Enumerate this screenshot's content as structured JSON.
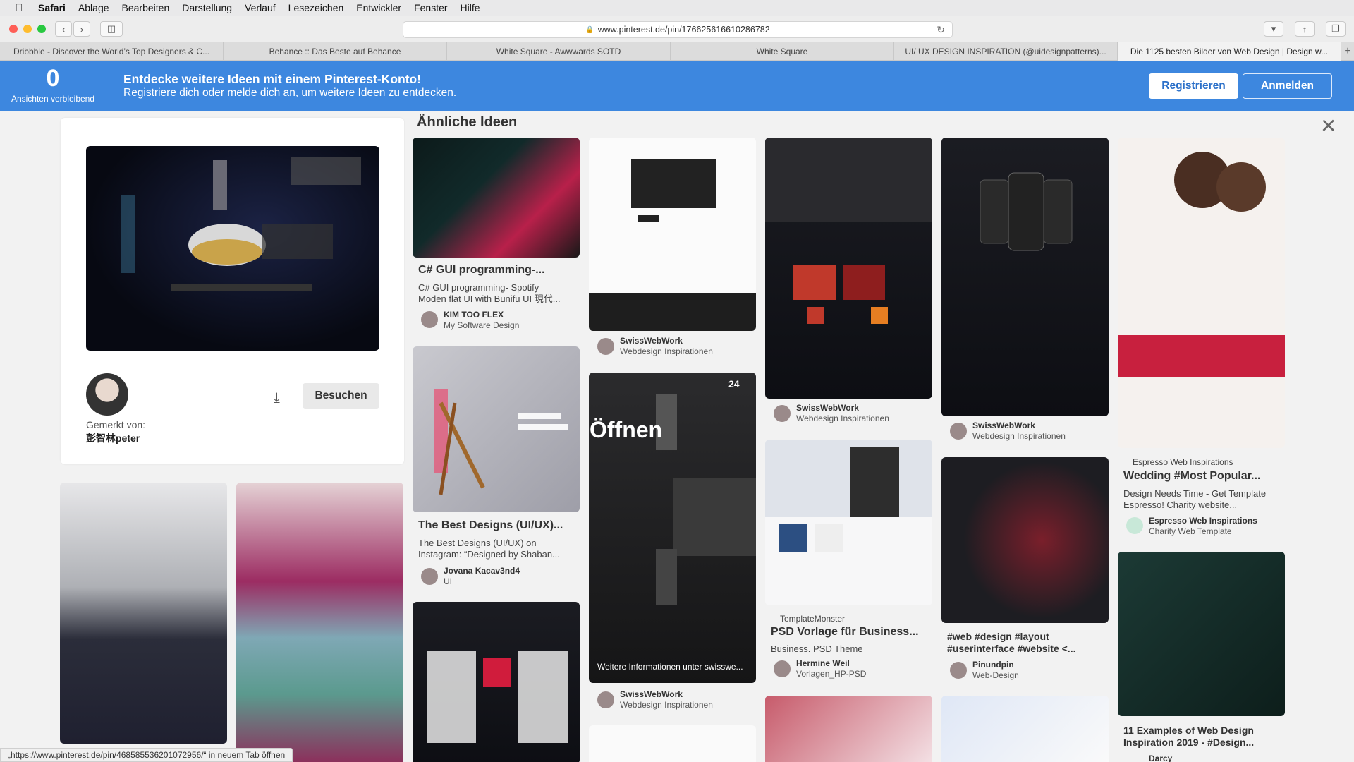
{
  "menubar": {
    "apple": "",
    "items": [
      "Safari",
      "Ablage",
      "Bearbeiten",
      "Darstellung",
      "Verlauf",
      "Lesezeichen",
      "Entwickler",
      "Fenster",
      "Hilfe"
    ]
  },
  "toolbar": {
    "url": "www.pinterest.de/pin/176625616610286782"
  },
  "tabs": [
    "Dribbble - Discover the World’s Top Designers & C...",
    "Behance :: Das Beste auf Behance",
    "White Square - Awwwards SOTD",
    "White Square",
    "UI/ UX DESIGN INSPIRATION (@uidesignpatterns)...",
    "Die 1125 besten Bilder von Web Design | Design w..."
  ],
  "banner": {
    "count": "0",
    "count_label": "Ansichten verbleibend",
    "headline": "Entdecke weitere Ideen mit einem Pinterest-Konto!",
    "subline": "Registriere dich oder melde dich an, um weitere Ideen zu entdecken.",
    "register": "Registrieren",
    "login": "Anmelden"
  },
  "detail": {
    "saved_label": "Gemerkt von:",
    "saved_user": "彭智林peter",
    "visit": "Besuchen"
  },
  "similar_title": "Ähnliche Ideen",
  "pins": {
    "p1": {
      "title": "C# GUI programming-...",
      "desc1": "C# GUI programming- Spotify",
      "desc2": "Moden flat UI with Bunifu UI 現代...",
      "name": "KIM TOO FLEX",
      "board": "My Software Design"
    },
    "p2": {
      "title": "The Best Designs (UI/UX)...",
      "desc1": "The Best Designs (UI/UX) on",
      "desc2": "Instagram: “Designed by Shaban...",
      "name": "Jovana Kacav3nd4",
      "board": "UI"
    },
    "p3": {
      "name": "SwissWebWork",
      "board": "Webdesign Inspirationen"
    },
    "p4": {
      "count": "24",
      "open": "Öffnen",
      "more": "Weitere Informationen unter swisswe...",
      "name": "SwissWebWork",
      "board": "Webdesign Inspirationen"
    },
    "p5": {
      "name": "SwissWebWork",
      "board": "Webdesign Inspirationen"
    },
    "p6": {
      "src": "TemplateMonster",
      "title": "PSD Vorlage für Business...",
      "desc1": "Business. PSD Theme",
      "name": "Hermine Weil",
      "board": "Vorlagen_HP-PSD"
    },
    "p7": {
      "name": "SwissWebWork",
      "board": "Webdesign Inspirationen"
    },
    "p8": {
      "title": "#web #design #layout",
      "title2": "#userinterface #website <...",
      "name": "Pinundpin",
      "board": "Web-Design"
    },
    "p9": {
      "src": "Espresso Web Inspirations",
      "title": "Wedding #Most Popular...",
      "desc1": "Design Needs Time - Get Template",
      "desc2": "Espresso! Charity website...",
      "name": "Espresso Web Inspirations",
      "board": "Charity Web Template"
    },
    "p10": {
      "title": "11 Examples of Web Design",
      "title2": "Inspiration 2019 - #Design...",
      "name": "Darcy"
    }
  },
  "statusbar": "„https://www.pinterest.de/pin/468585536201072956/“ in neuem Tab öffnen"
}
